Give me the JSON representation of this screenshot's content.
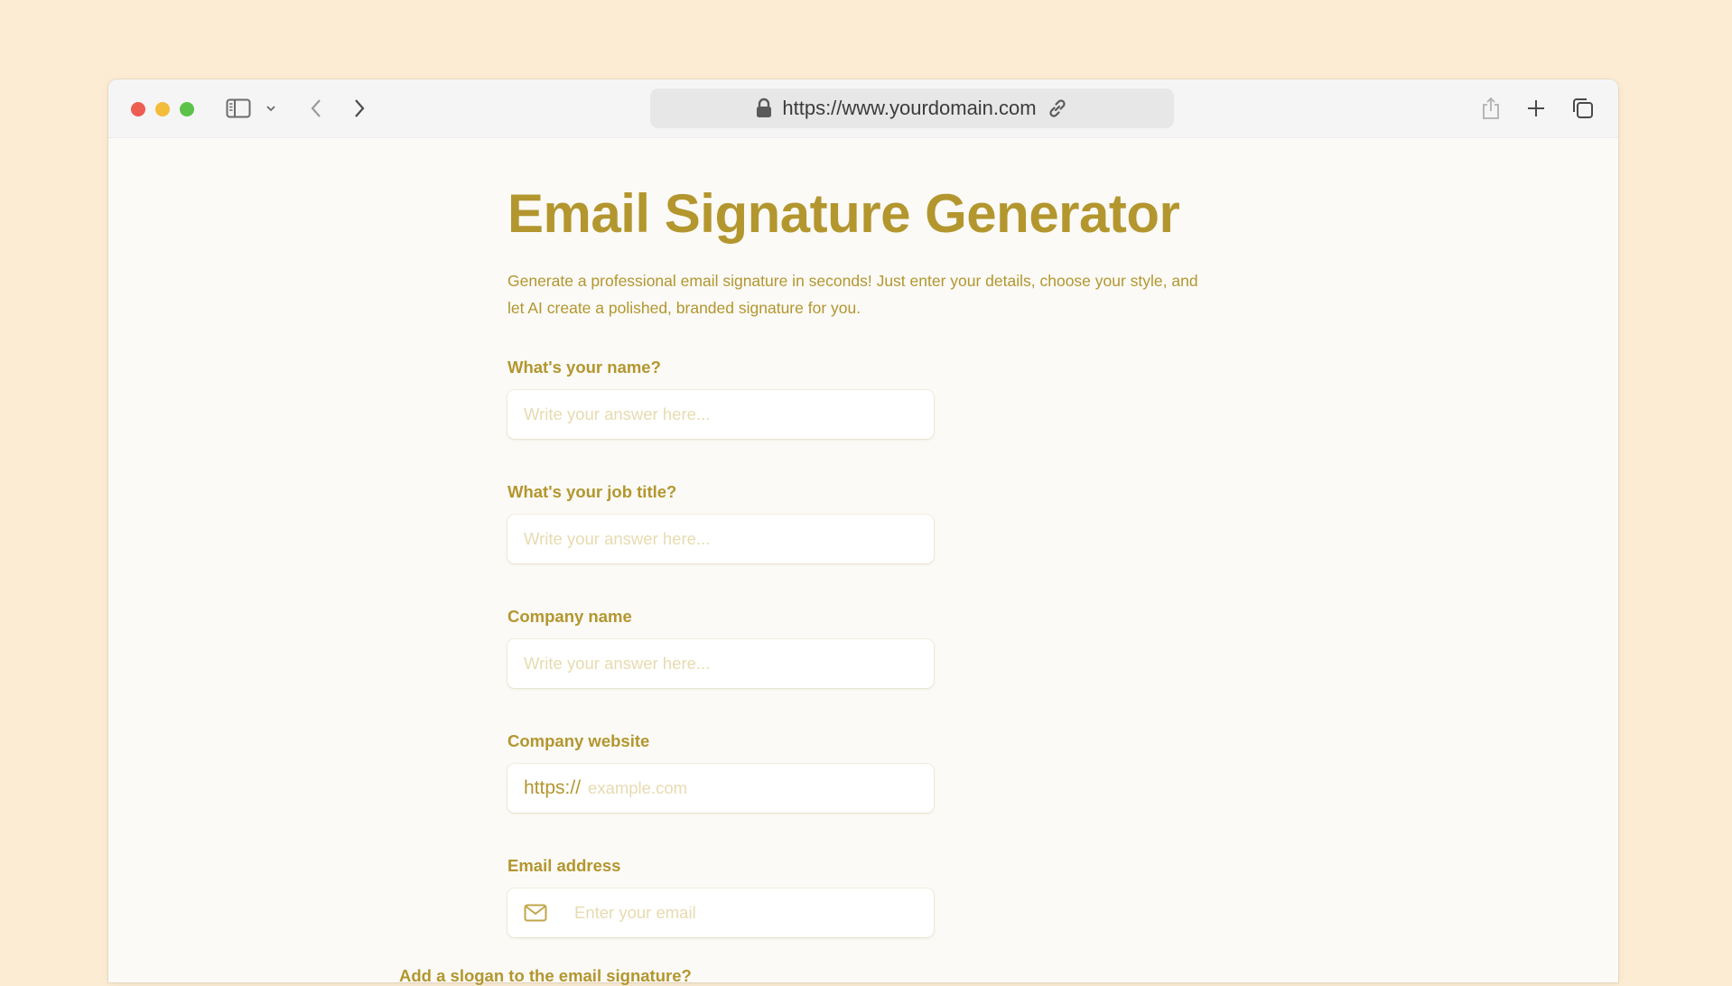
{
  "browser": {
    "url": "https://www.yourdomain.com"
  },
  "page": {
    "title": "Email Signature Generator",
    "subtitle": "Generate a professional email signature in seconds! Just enter your details, choose your style, and let AI create a polished, branded signature for you."
  },
  "form": {
    "name": {
      "label": "What's your name?",
      "placeholder": "Write your answer here..."
    },
    "job_title": {
      "label": "What's your job title?",
      "placeholder": "Write your answer here..."
    },
    "company_name": {
      "label": "Company name",
      "placeholder": "Write your answer here..."
    },
    "company_website": {
      "label": "Company website",
      "prefix": "https://",
      "placeholder": "example.com"
    },
    "email": {
      "label": "Email address",
      "placeholder": "Enter your email",
      "icon": "mail-icon"
    },
    "slogan": {
      "label": "Add a slogan to the email signature?"
    }
  },
  "colors": {
    "background": "#fcecd3",
    "accent": "#b3962e",
    "placeholder": "#e7dbb0"
  }
}
